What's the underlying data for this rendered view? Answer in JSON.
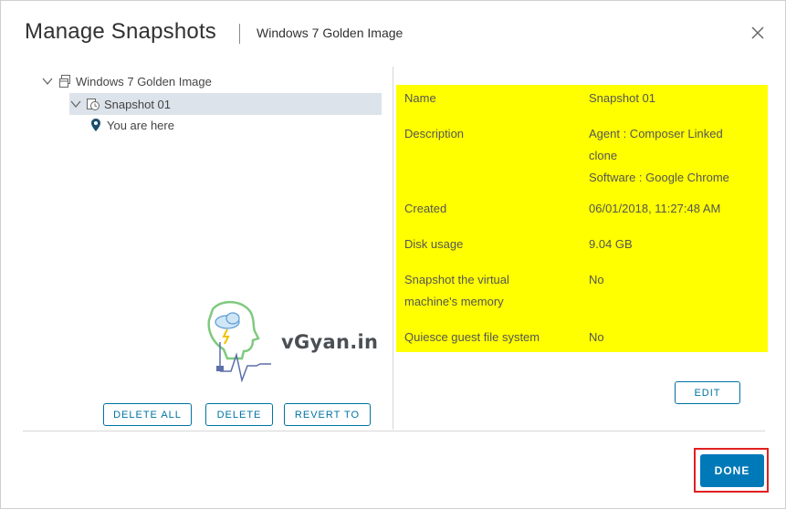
{
  "dialog": {
    "title": "Manage Snapshots",
    "subtitle": "Windows 7 Golden Image",
    "close_icon": "close-icon"
  },
  "tree": {
    "root": {
      "label": "Windows 7 Golden Image",
      "icon": "vm-icon",
      "expanded": true
    },
    "snapshot": {
      "label": "Snapshot 01",
      "icon": "snapshot-icon",
      "expanded": true,
      "selected": true
    },
    "current": {
      "label": "You are here",
      "icon": "location-pin-icon"
    }
  },
  "left_actions": {
    "delete_all": "DELETE ALL",
    "delete": "DELETE",
    "revert_to": "REVERT TO"
  },
  "logo": {
    "text": "vGyan.in"
  },
  "details": {
    "highlight_color": "#ffff00",
    "rows": [
      {
        "label": "Name",
        "value": [
          "Snapshot 01"
        ]
      },
      {
        "label": "Description",
        "value": [
          "Agent : Composer Linked",
          "clone",
          "Software : Google Chrome"
        ]
      },
      {
        "label": "Created",
        "value": [
          "06/01/2018, 11:27:48 AM"
        ]
      },
      {
        "label": "Disk usage",
        "value": [
          "9.04 GB"
        ]
      },
      {
        "label": [
          "Snapshot the virtual",
          "machine's memory"
        ],
        "value": [
          "No"
        ]
      },
      {
        "label": "Quiesce guest file system",
        "value": [
          "No"
        ]
      }
    ]
  },
  "edit_label": "EDIT",
  "done_label": "DONE",
  "colors": {
    "accent": "#0079b8",
    "button_outline": "#0072a3",
    "highlight_border": "#e02020"
  }
}
